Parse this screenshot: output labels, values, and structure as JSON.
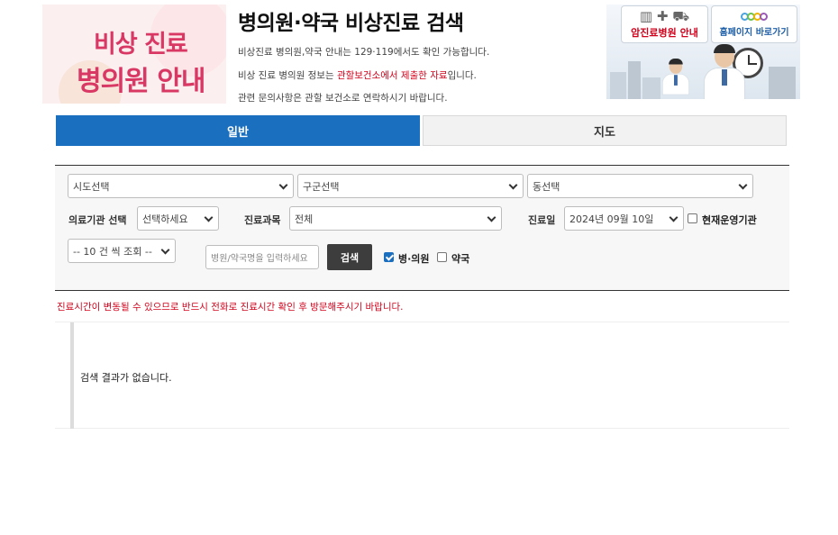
{
  "header": {
    "logo_line1": "비상 진료",
    "logo_line2": "병의원 안내",
    "title": "병의원·약국 비상진료 검색",
    "info1": "비상진료 병의원,약국 안내는 129·119에서도 확인 가능합니다.",
    "info2_prefix": "비상 진료 병의원 정보는 ",
    "info2_highlight": "관할보건소에서 제출한 자료",
    "info2_suffix": "입니다.",
    "info3": "관련 문의사항은 관할 보건소로 연락하시기 바랍니다.",
    "highlight_color": "#d0021b"
  },
  "banner": {
    "cancer_hospital_label": "암진료병원 안내",
    "homepage_label": "홈페이지 바로가기",
    "icons": [
      "hospital-icon",
      "pharmacy-icon",
      "ambulance-icon"
    ]
  },
  "tabs": [
    {
      "label": "일반",
      "active": true
    },
    {
      "label": "지도",
      "active": false
    }
  ],
  "filters": {
    "sido": "시도선택",
    "gugun": "구군선택",
    "dong": "동선택",
    "institution_label": "의료기관 선택",
    "institution_value": "선택하세요",
    "department_label": "진료과목",
    "department_value": "전체",
    "date_label": "진료일",
    "date_value": "2024년 09월 10일",
    "open_now_label": "현재운영기관",
    "open_now_checked": false,
    "page_size": "-- 10 건 씩 조회 --",
    "search_placeholder": "병원/약국명을 입력하세요",
    "search_button": "검색",
    "hospital_label": "병·의원",
    "hospital_checked": true,
    "pharmacy_label": "약국",
    "pharmacy_checked": false
  },
  "notice": "진료시간이 변동될 수 있으므로 반드시 전화로 진료시간 확인 후 방문해주시기 바랍니다.",
  "results": {
    "empty_message": "검색 결과가 없습니다."
  },
  "colors": {
    "tab_active": "#1a6fbf",
    "logo_text": "#d93865",
    "notice": "#d0021b"
  }
}
